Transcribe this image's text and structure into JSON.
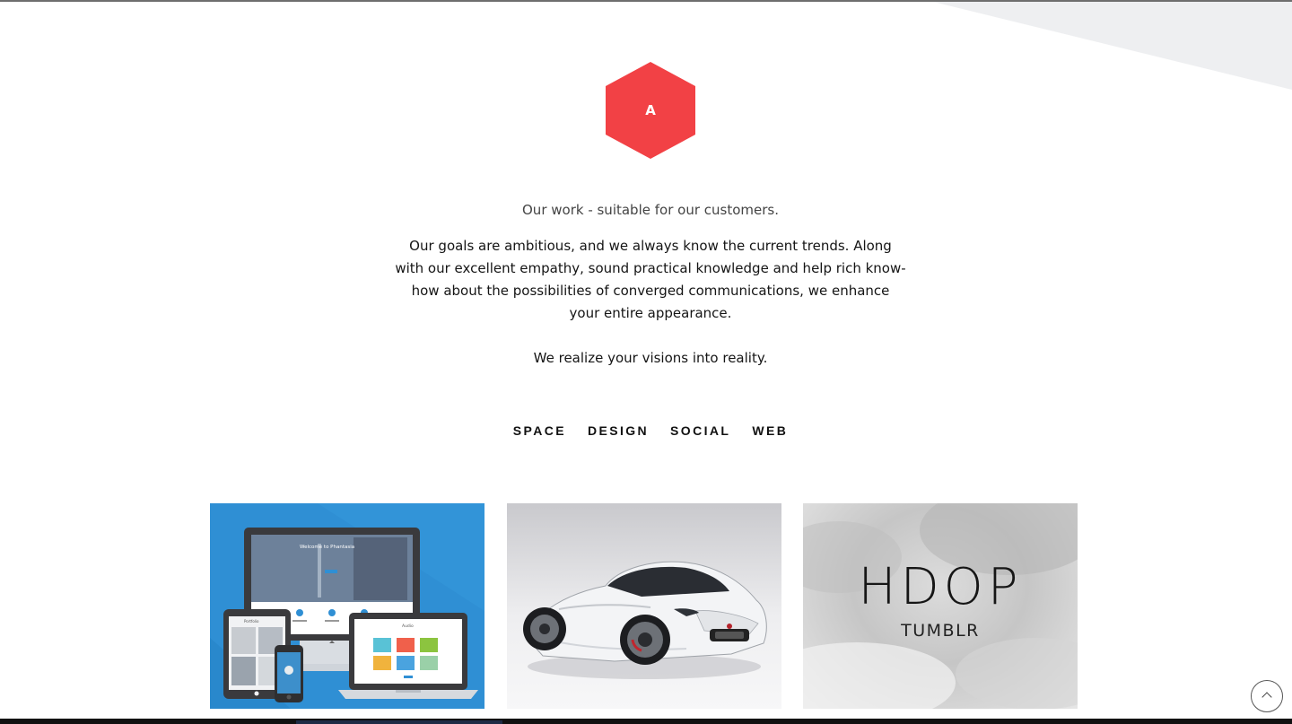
{
  "brand": {
    "logo_letter": "A",
    "logo_color": "#f24145"
  },
  "hero": {
    "headline": "Our work - suitable for our customers.",
    "intro": "Our goals are ambitious, and we always know the current trends. Along with our excellent empathy, sound practical knowledge and help rich know-how about the possibilities of converged communications, we enhance your entire appearance.",
    "tagline": "We realize your visions into reality."
  },
  "filters": [
    {
      "label": "SPACE"
    },
    {
      "label": "DESIGN"
    },
    {
      "label": "SOCIAL"
    },
    {
      "label": "WEB"
    }
  ],
  "portfolio": {
    "tile1": {
      "screen_title": "Welcome to Phantasia",
      "tablet_title": "Portfolio",
      "laptop_title": "Audio",
      "accent": "#2f8fd4"
    },
    "tile3": {
      "title": "HDOP",
      "subtitle": "TUMBLR"
    }
  },
  "scroll_top": {
    "icon": "chevron-up-icon"
  }
}
